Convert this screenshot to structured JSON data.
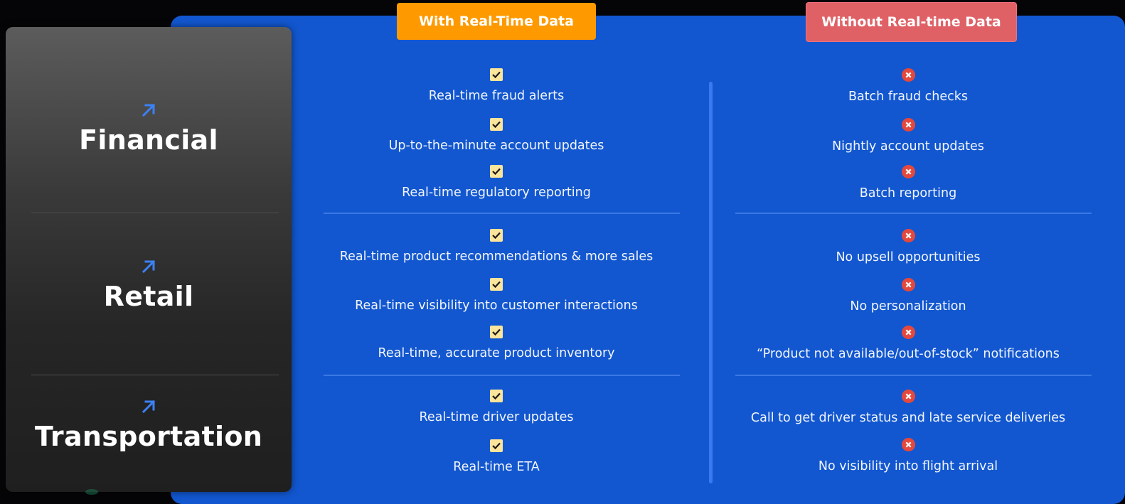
{
  "header": {
    "with_label": "With Real-Time Data",
    "without_label": "Without Real-time Data"
  },
  "categories": [
    {
      "label": "Financial",
      "icon": "arrow-up-right-icon"
    },
    {
      "label": "Retail",
      "icon": "arrow-up-right-icon"
    },
    {
      "label": "Transportation",
      "icon": "arrow-up-right-icon"
    }
  ],
  "with": {
    "financial": [
      "Real-time fraud alerts",
      "Up-to-the-minute account updates",
      "Real-time regulatory reporting"
    ],
    "retail": [
      "Real-time product recommendations & more sales",
      "Real-time visibility into customer interactions",
      "Real-time, accurate product inventory"
    ],
    "transportation": [
      "Real-time driver updates",
      "Real-time ETA"
    ]
  },
  "without": {
    "financial": [
      "Batch fraud checks",
      "Nightly account updates",
      "Batch reporting"
    ],
    "retail": [
      "No upsell opportunities",
      "No personalization",
      "“Product not available/out-of-stock” notifications"
    ],
    "transportation": [
      "Call to get driver status and late service deliveries",
      "No visibility into flight arrival"
    ]
  },
  "colors": {
    "panel": "#1257cf",
    "with_badge": "#fe9a00",
    "without_badge": "#df6166",
    "check": "#fbe49b",
    "x": "#e5483d",
    "arrow": "#3b82f6"
  }
}
